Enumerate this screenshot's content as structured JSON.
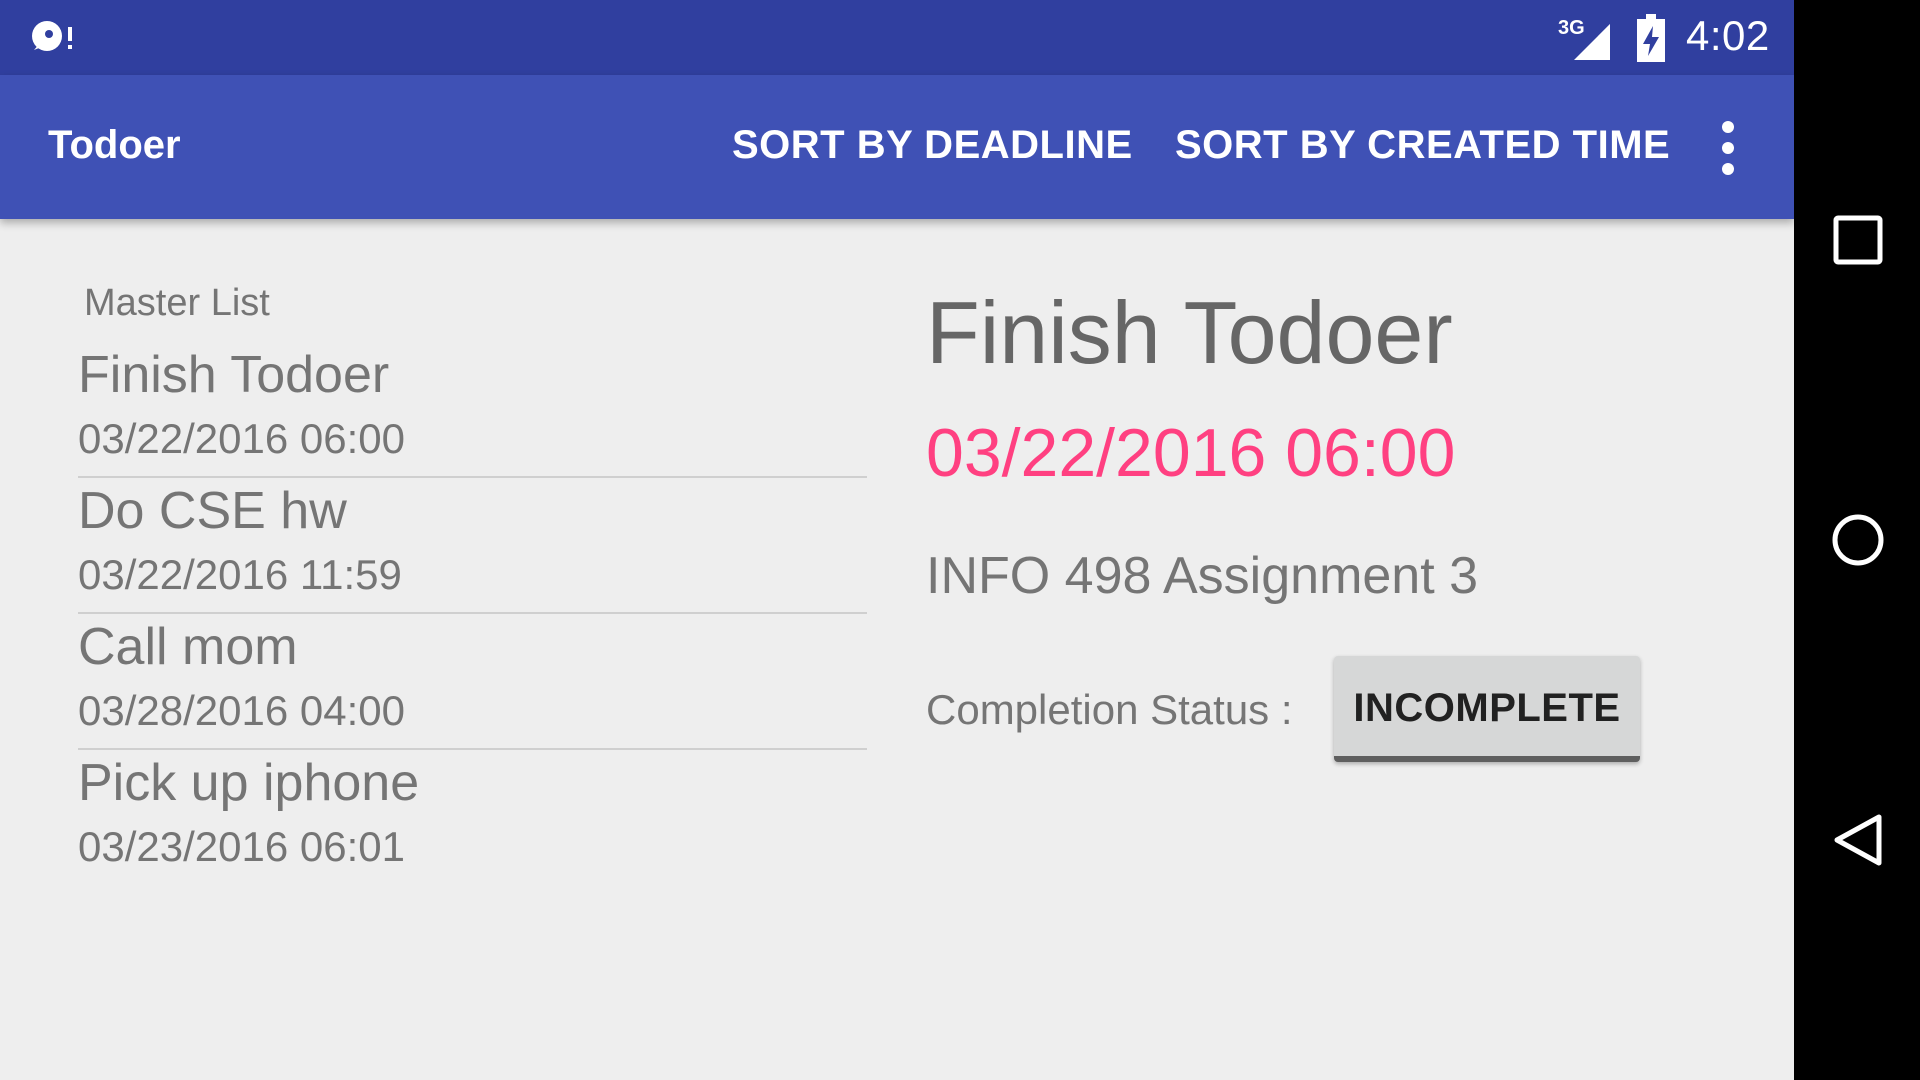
{
  "status_bar": {
    "network": "3G",
    "time": "4:02"
  },
  "action_bar": {
    "title": "Todoer",
    "actions": [
      "SORT BY DEADLINE",
      "SORT BY CREATED TIME"
    ],
    "overflow_icon": "more-vert-icon"
  },
  "master_list": {
    "label": "Master List",
    "items": [
      {
        "title": "Finish Todoer",
        "deadline": "03/22/2016 06:00"
      },
      {
        "title": "Do CSE hw",
        "deadline": "03/22/2016 11:59"
      },
      {
        "title": "Call mom",
        "deadline": "03/28/2016 04:00"
      },
      {
        "title": "Pick up iphone",
        "deadline": "03/23/2016 06:01"
      }
    ]
  },
  "detail": {
    "title": "Finish Todoer",
    "deadline": "03/22/2016 06:00",
    "description": "INFO 498 Assignment 3",
    "status_label": "Completion Status :",
    "status_button": "INCOMPLETE"
  },
  "nav_bar": {
    "icons": [
      "recents-icon",
      "home-icon",
      "back-icon"
    ]
  },
  "colors": {
    "status_bar": "#303f9f",
    "action_bar": "#3f51b5",
    "accent": "#ff4081",
    "background": "#eeeeee"
  }
}
